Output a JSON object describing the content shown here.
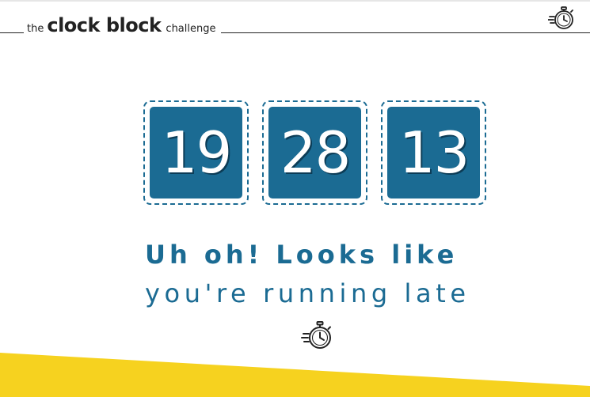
{
  "header": {
    "brand_prefix": "the",
    "brand_name": "clock block",
    "brand_suffix": "challenge",
    "icon": "stopwatch-icon"
  },
  "clock": {
    "hours": "19",
    "minutes": "28",
    "seconds": "13"
  },
  "message": {
    "line1": "Uh oh! Looks like",
    "line2": "you're running late",
    "icon": "stopwatch-icon"
  },
  "colors": {
    "accent": "#1b6b93",
    "digit_shadow": "#0c3c56",
    "band": "#f6d21f",
    "text_dark": "#222222"
  }
}
